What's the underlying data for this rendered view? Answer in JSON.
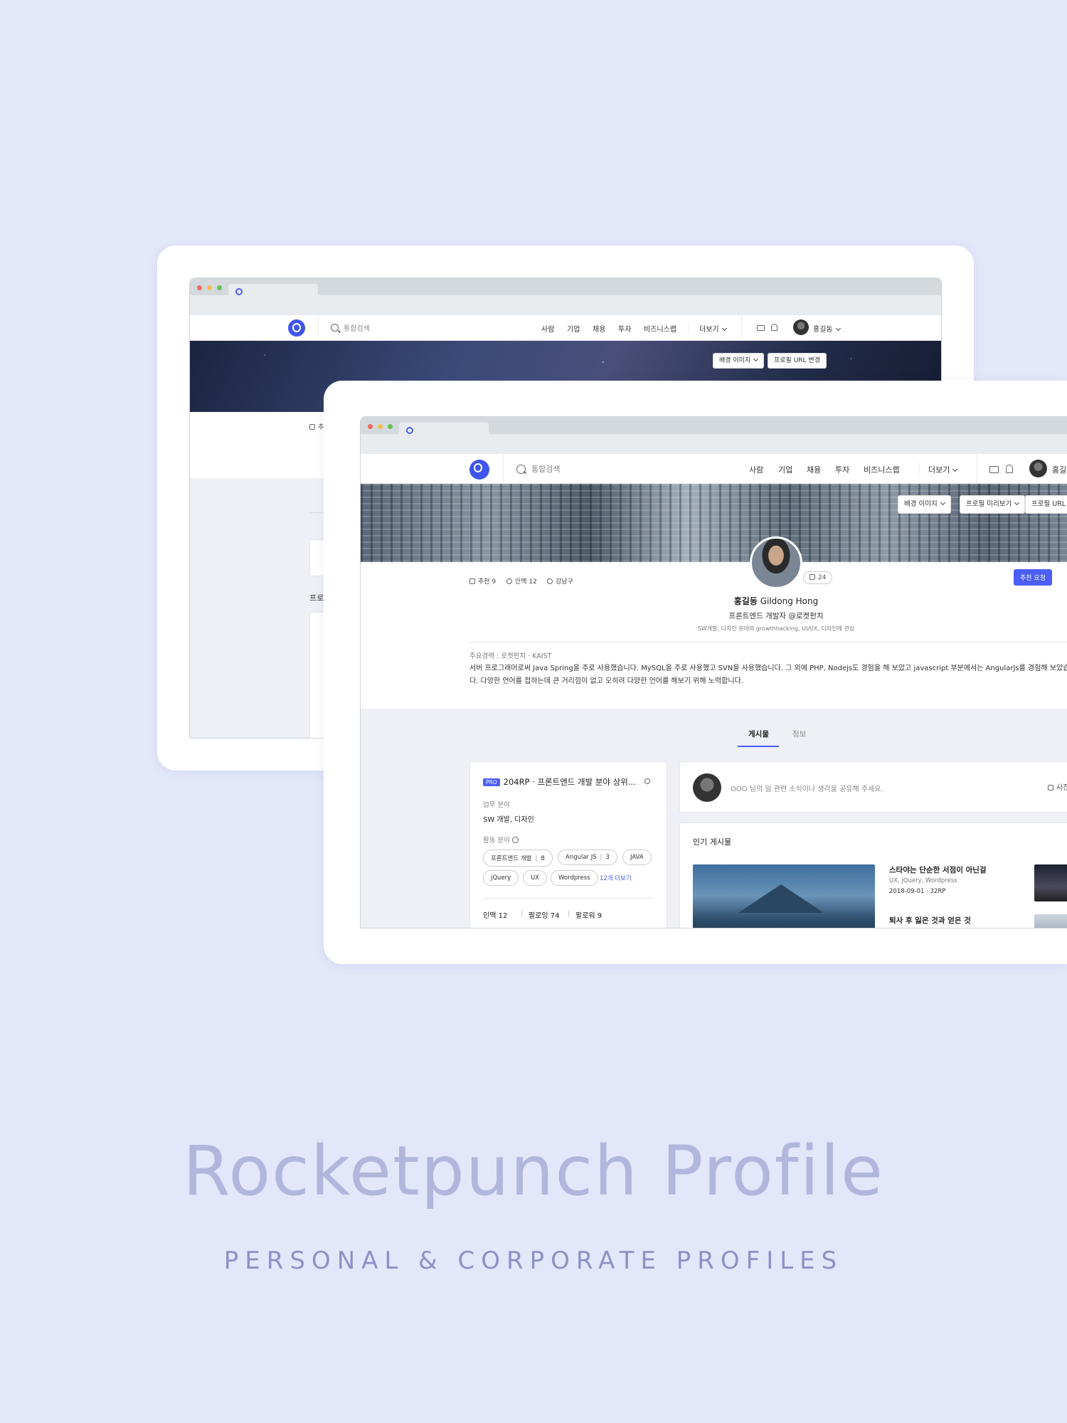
{
  "back_window": {
    "search_placeholder": "통합검색",
    "menu": [
      "사람",
      "기업",
      "채용",
      "투자",
      "비즈니스랩"
    ],
    "more_label": "더보기",
    "user_name": "홍길동",
    "banner_buttons": [
      "배경 이미지",
      "프로필 URL 변경"
    ],
    "partial_stat": "추",
    "partial_heading": "프로"
  },
  "front_window": {
    "search_placeholder": "통합검색",
    "menu": [
      "사람",
      "기업",
      "채용",
      "투자",
      "비즈니스랩"
    ],
    "more_label": "더보기",
    "user_name": "홍길",
    "banner_buttons": [
      "배경 이미지",
      "프로필 미리보기",
      "프로필 URL 변"
    ],
    "profile": {
      "stats": [
        "추천 9",
        "인맥 12",
        "강남구"
      ],
      "like_count": "24",
      "name_ko": "홍길동",
      "name_en": "Gildong Hong",
      "role": "프론트엔드 개발자 @로켓펀치",
      "interests": "SW개발, 디자인 분야의 growthhacking, UI/UX, 디자인에 관심",
      "recommend_button": "추천 요청",
      "career": "주요경력 : 로켓펀치 · KAIST",
      "bio": "서버 프로그래머로써 Java Spring을 주로 사용했습니다. MySQL을 주로 사용했고 SVN을 사용했습니다. 그 외에 PHP, Nodejs도 경험을 해 보았고 javascript 부분에서는 AngularJs를 경험해 보았습니다. 다양한 언어를 접하는데 큰 거리낌이 없고 오히려 다양한 언어를 해보기 위해 노력합니다."
    },
    "tabs": [
      "게시물",
      "정보"
    ],
    "left_panel": {
      "badge": "PRO",
      "title": "204RP · 프론트엔드 개발 분야 상위...",
      "work_field_label": "업무 분야",
      "work_field_value": "SW 개발, 디자인",
      "activity_label": "활동 분야",
      "tags": [
        {
          "name": "프론트엔드 개발",
          "count": "8"
        },
        {
          "name": "Angular JS",
          "count": "3"
        },
        {
          "name": "JAVA",
          "count": ""
        },
        {
          "name": "jQuery",
          "count": ""
        },
        {
          "name": "UX",
          "count": ""
        },
        {
          "name": "Wordpress",
          "count": ""
        }
      ],
      "more_link": "12개 더보기",
      "connections": [
        "인맥 12",
        "팔로잉 74",
        "팔로워 9"
      ]
    },
    "composer": {
      "placeholder": "OOO 님의 일 관련 소식이나 생각을 공유해 주세요.",
      "photo_label": "사진"
    },
    "popular": {
      "heading": "인기 게시물",
      "posts": [
        {
          "title": "스타야는 단순한 서점이 아닌걸",
          "tags": "UX, jQuery, Wordpress",
          "meta": "2018-09-01 · 32RP"
        },
        {
          "title": "퇴사 후 잃은 것과 얻은 것",
          "tags": "",
          "meta": ""
        }
      ]
    }
  },
  "footer": {
    "title": "Rocketpunch Profile",
    "subtitle": "PERSONAL & CORPORATE PROFILES"
  },
  "colors": {
    "background": "#e3e7fa",
    "accent": "#4b5ff5",
    "title_text": "#b1b6dc",
    "subtitle_text": "#8c92c6"
  }
}
